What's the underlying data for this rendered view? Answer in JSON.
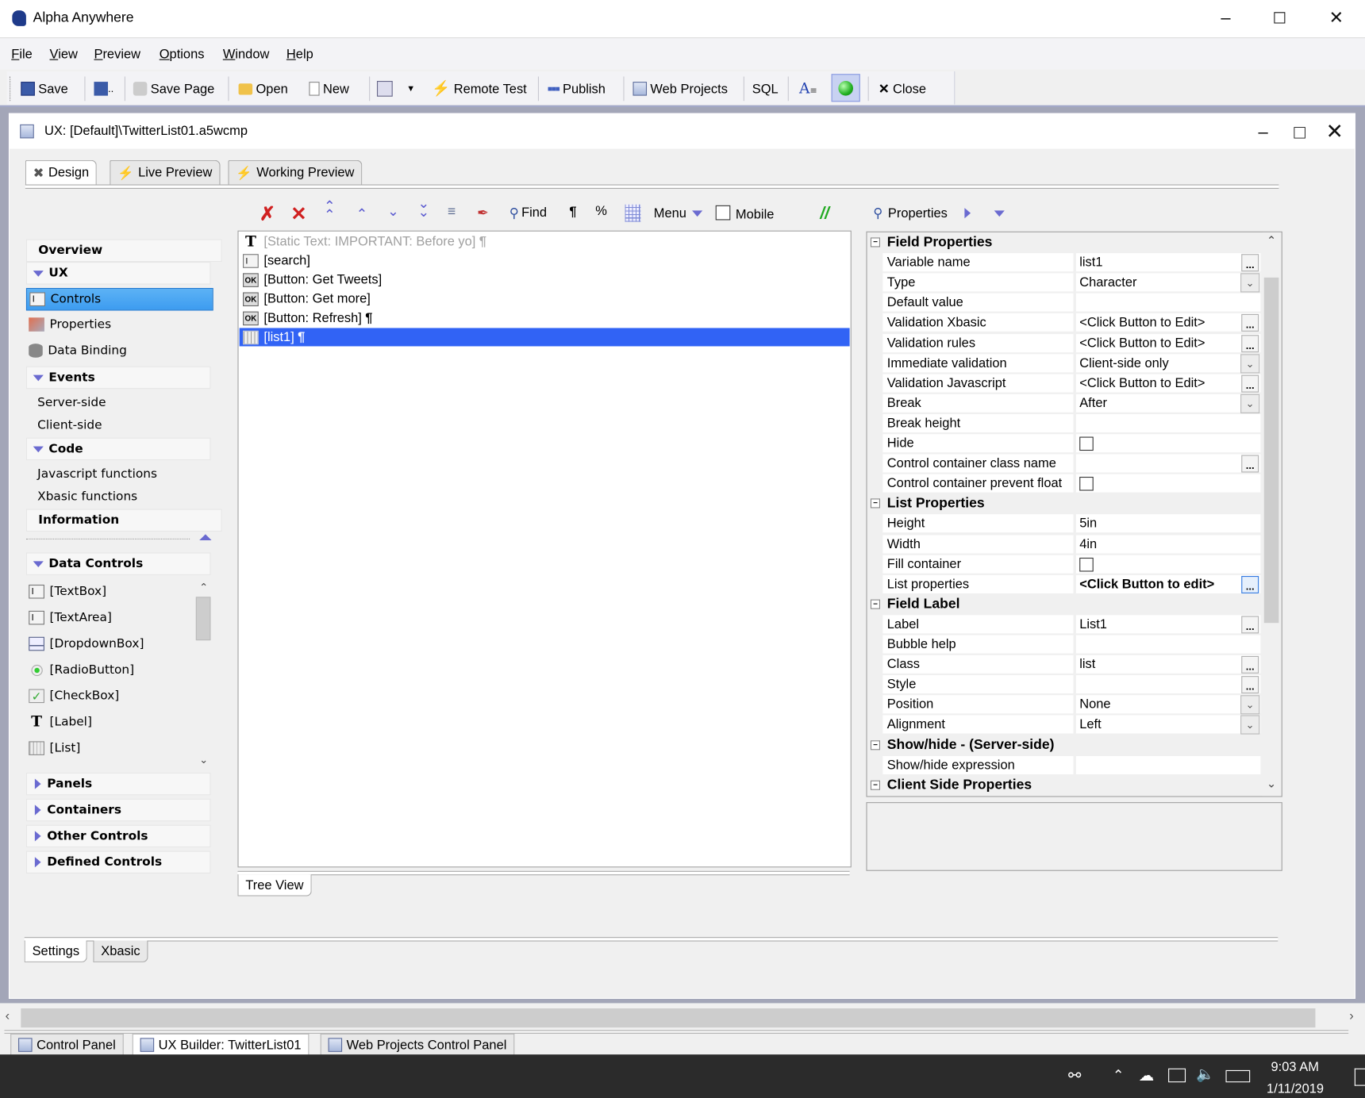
{
  "app": {
    "title": "Alpha Anywhere"
  },
  "menu": [
    "File",
    "View",
    "Preview",
    "Options",
    "Window",
    "Help"
  ],
  "toolbar": {
    "save": "Save",
    "save_page": "Save Page",
    "open": "Open",
    "new": "New",
    "remote_test": "Remote Test",
    "publish": "Publish",
    "web_projects": "Web Projects",
    "sql": "SQL",
    "close": "Close"
  },
  "document": {
    "title": "UX: [Default]\\TwitterList01.a5wcmp"
  },
  "mode_tabs": [
    {
      "label": "Design",
      "active": true
    },
    {
      "label": "Live Preview",
      "active": false
    },
    {
      "label": "Working Preview",
      "active": false
    }
  ],
  "left_nav": [
    {
      "label": "Overview",
      "kind": "header"
    },
    {
      "label": "UX",
      "kind": "group"
    },
    {
      "label": "Controls",
      "kind": "item",
      "icon": "textbox-icon",
      "selected": true
    },
    {
      "label": "Properties",
      "kind": "item",
      "icon": "properties-icon"
    },
    {
      "label": "Data Binding",
      "kind": "item",
      "icon": "database-icon"
    },
    {
      "label": "Events",
      "kind": "group"
    },
    {
      "label": "Server-side",
      "kind": "sub"
    },
    {
      "label": "Client-side",
      "kind": "sub"
    },
    {
      "label": "Code",
      "kind": "group"
    },
    {
      "label": "Javascript functions",
      "kind": "sub"
    },
    {
      "label": "Xbasic functions",
      "kind": "sub"
    },
    {
      "label": "Information",
      "kind": "header"
    }
  ],
  "control_groups": {
    "expanded": {
      "label": "Data Controls",
      "items": [
        {
          "label": "[TextBox]",
          "icon": "textbox-icon"
        },
        {
          "label": "[TextArea]",
          "icon": "textarea-icon"
        },
        {
          "label": "[DropdownBox]",
          "icon": "dropdown-icon"
        },
        {
          "label": "[RadioButton]",
          "icon": "radio-icon"
        },
        {
          "label": "[CheckBox]",
          "icon": "checkbox-icon"
        },
        {
          "label": "[Label]",
          "icon": "label-icon"
        },
        {
          "label": "[List]",
          "icon": "list-icon"
        }
      ]
    },
    "collapsed": [
      "Panels",
      "Containers",
      "Other Controls",
      "Defined Controls"
    ]
  },
  "designer_toolbar": {
    "find": "Find",
    "pilcrow": "¶",
    "percent": "%",
    "menu": "Menu",
    "mobile": "Mobile",
    "mobile_checked": false
  },
  "tree": {
    "items": [
      {
        "label": "[Static Text: IMPORTANT: Before yo]",
        "suffix": "¶",
        "icon": "static-text-icon",
        "dim": true
      },
      {
        "label": "[search]",
        "suffix": "",
        "icon": "textbox-icon"
      },
      {
        "label": "[Button: Get Tweets]",
        "suffix": "",
        "icon": "button-icon"
      },
      {
        "label": "[Button: Get more]",
        "suffix": "",
        "icon": "button-icon"
      },
      {
        "label": "[Button: Refresh]",
        "suffix": "¶",
        "icon": "button-icon"
      },
      {
        "label": "[list1]",
        "suffix": "¶",
        "icon": "list-icon",
        "selected": true
      }
    ],
    "view_tab": "Tree View"
  },
  "properties": {
    "title": "Properties",
    "sections": [
      {
        "title": "Field Properties",
        "rows": [
          {
            "name": "Variable name",
            "value": "list1",
            "control": "ellipsis"
          },
          {
            "name": "Type",
            "value": "Character",
            "control": "dropdown"
          },
          {
            "name": "Default value",
            "value": "",
            "control": "none"
          },
          {
            "name": "Validation Xbasic",
            "value": "<Click Button to Edit>",
            "control": "ellipsis"
          },
          {
            "name": "Validation rules",
            "value": "<Click Button to Edit>",
            "control": "ellipsis"
          },
          {
            "name": "Immediate validation",
            "value": "Client-side only",
            "control": "dropdown"
          },
          {
            "name": "Validation Javascript",
            "value": "<Click Button to Edit>",
            "control": "ellipsis"
          },
          {
            "name": "Break",
            "value": "After",
            "control": "dropdown"
          },
          {
            "name": "Break height",
            "value": "",
            "control": "none"
          },
          {
            "name": "Hide",
            "value": "",
            "control": "checkbox",
            "checked": false
          },
          {
            "name": "Control container class name",
            "value": "",
            "control": "ellipsis"
          },
          {
            "name": "Control container prevent float",
            "value": "",
            "control": "checkbox",
            "checked": false
          }
        ]
      },
      {
        "title": "List Properties",
        "rows": [
          {
            "name": "Height",
            "value": "5in",
            "control": "none"
          },
          {
            "name": "Width",
            "value": "4in",
            "control": "none"
          },
          {
            "name": "Fill container",
            "value": "",
            "control": "checkbox",
            "checked": false
          },
          {
            "name": "List properties",
            "value": "<Click Button to edit>",
            "control": "ellipsis",
            "bold": true,
            "focused": true
          }
        ]
      },
      {
        "title": "Field Label",
        "rows": [
          {
            "name": "Label",
            "value": "List1",
            "control": "ellipsis"
          },
          {
            "name": "Bubble help",
            "value": "",
            "control": "none"
          },
          {
            "name": "Class",
            "value": "list",
            "control": "ellipsis"
          },
          {
            "name": "Style",
            "value": "",
            "control": "ellipsis"
          },
          {
            "name": "Position",
            "value": "None",
            "control": "dropdown"
          },
          {
            "name": "Alignment",
            "value": "Left",
            "control": "dropdown"
          }
        ]
      },
      {
        "title": "Show/hide - (Server-side)",
        "rows": [
          {
            "name": "Show/hide expression",
            "value": "",
            "control": "none"
          }
        ]
      },
      {
        "title": "Client Side Properties",
        "rows": []
      }
    ]
  },
  "bottom_tabs": [
    {
      "label": "Settings",
      "active": true
    },
    {
      "label": "Xbasic",
      "active": false
    }
  ],
  "doc_tabs": [
    {
      "label": "Control Panel",
      "active": false
    },
    {
      "label": "UX Builder: TwitterList01",
      "active": true
    },
    {
      "label": "Web Projects Control Panel",
      "active": false
    }
  ],
  "taskbar": {
    "time": "9:03 AM",
    "date": "1/11/2019"
  },
  "colors": {
    "selection": "#3163f5",
    "nav_selected": "#3d9cf0",
    "accent": "#6a6ad0"
  }
}
